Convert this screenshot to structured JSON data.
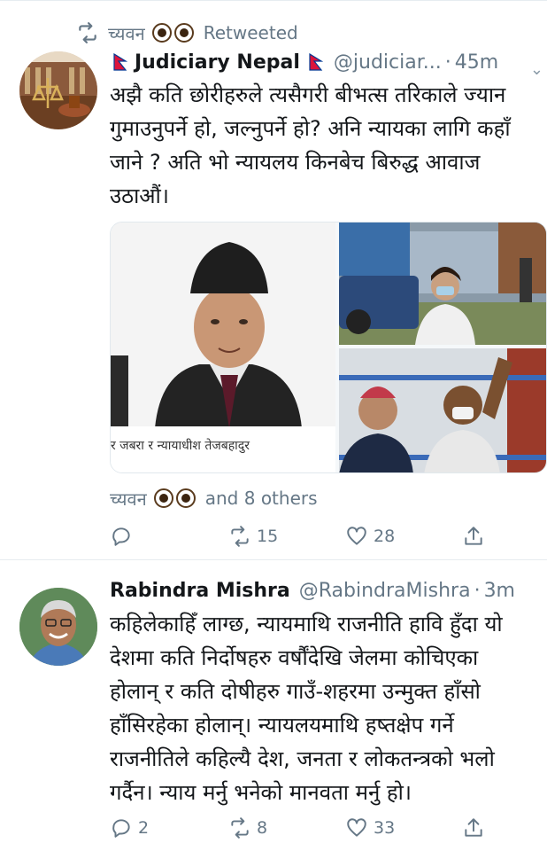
{
  "colors": {
    "text": "#14171a",
    "muted": "#657786",
    "border": "#e6ecf0"
  },
  "tweet1": {
    "retweet_icon": "retweet-icon",
    "retweeted_by": "च्यवन",
    "retweeted_label": "Retweeted",
    "name": "Judiciary Nepal",
    "handle": "@judiciar...",
    "dot": "·",
    "time": "45m",
    "text": "अझै कति छोरीहरुले त्यसैगरी बीभत्स तरिकाले ज्यान गुमाउनुपर्ने हो, जल्नुपर्ने हो? अनि न्यायका लागि कहाँ जाने ? अति भो न्यायलय किनबेच बिरुद्ध आवाज उठाऔं।",
    "media_caption": "र जबरा र न्यायाधीश तेजबहादुर",
    "liked_by": "च्यवन",
    "liked_others": "and 8 others",
    "replies": "",
    "retweets": "15",
    "likes": "28"
  },
  "tweet2": {
    "name": "Rabindra Mishra",
    "handle": "@RabindraMishra",
    "dot": "·",
    "time": "3m",
    "text": "कहिलेकाहिँ लाग्छ, न्यायमाथि राजनीति हावि हुँदा यो देशमा कति निर्दोषहरु वर्षौंदेखि जेलमा कोचिएका होलान् र कति दोषीहरु गाउँ-शहरमा उन्मुक्त हाँसो हाँसिरहेका होलान्। न्यायलयमाथि हष्तक्षेप गर्ने राजनीतिले कहिल्यै देश, जनता र लोकतन्त्रको भलो गर्दैन। न्याय मर्नु भनेको मानवता मर्नु हो।",
    "replies": "2",
    "retweets": "8",
    "likes": "33"
  }
}
